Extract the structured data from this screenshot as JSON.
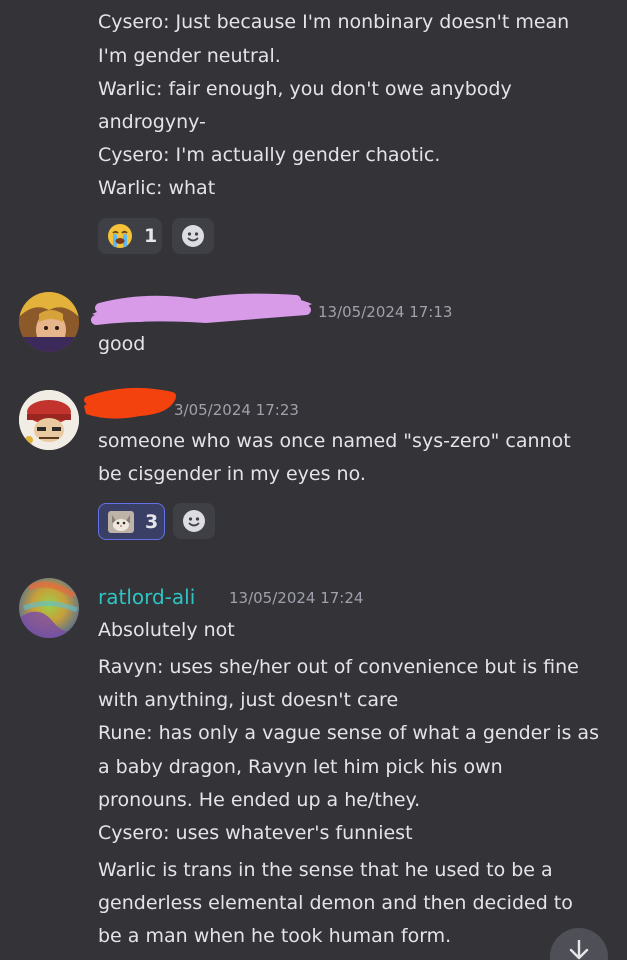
{
  "messages": [
    {
      "id": "top",
      "lines": [
        "Cysero: Just because I'm nonbinary doesn't mean",
        "I'm gender neutral.",
        "Warlic: fair enough, you don't owe anybody",
        "androgyny-",
        "Cysero: I'm actually gender chaotic.",
        "Warlic: what"
      ],
      "reaction": {
        "emoji": "sob-emoji",
        "count": "1"
      }
    },
    {
      "id": "msg2",
      "username_redacted": true,
      "redaction_color": "#d79be8",
      "timestamp": "13/05/2024 17:13",
      "lines": [
        "good"
      ]
    },
    {
      "id": "msg3",
      "username_redacted": true,
      "redaction_color": "#f3420e",
      "timestamp": "3/05/2024 17:23",
      "lines": [
        "someone who was once named \"sys-zero\" cannot",
        "be cisgender in my eyes no."
      ],
      "reaction": {
        "emoji": "cat-emoji",
        "count": "3",
        "active": true
      }
    },
    {
      "id": "msg4",
      "username": "ratlord-ali",
      "username_color": "#2fc4c4",
      "timestamp": "13/05/2024 17:24",
      "lines": [
        "Absolutely not",
        "Ravyn: uses she/her out of convenience but is fine",
        "with anything, just doesn't care",
        "Rune: has only a vague sense of what a gender is as",
        "a baby dragon, Ravyn let him pick his own",
        "pronouns. He ended up a he/they.",
        "Cysero: uses whatever's funniest",
        "Warlic is trans in the sense that he used to be a",
        "genderless elemental demon and then decided to",
        "be a man when he took human form."
      ]
    }
  ],
  "icons": {
    "add_reaction": "smile-plus-icon",
    "scroll_down": "arrow-down-icon"
  }
}
